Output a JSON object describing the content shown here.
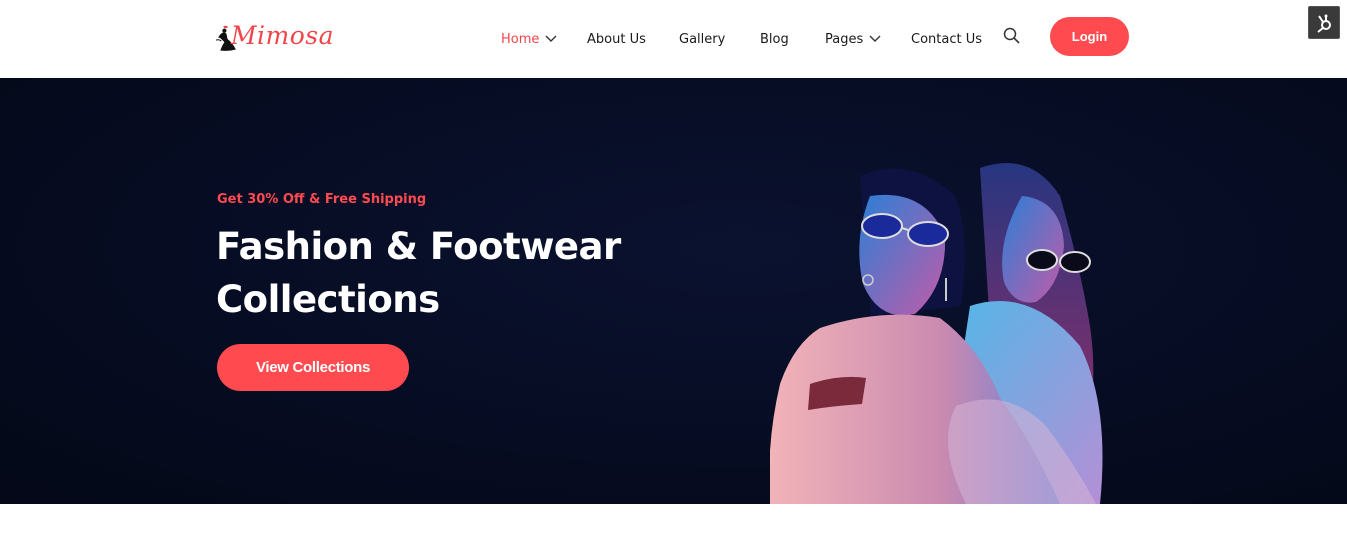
{
  "brand": {
    "name": "Mimosa"
  },
  "nav": {
    "items": [
      {
        "label": "Home",
        "active": true,
        "has_dropdown": true
      },
      {
        "label": "About Us",
        "active": false,
        "has_dropdown": false
      },
      {
        "label": "Gallery",
        "active": false,
        "has_dropdown": false
      },
      {
        "label": "Blog",
        "active": false,
        "has_dropdown": false
      },
      {
        "label": "Pages",
        "active": false,
        "has_dropdown": true
      },
      {
        "label": "Contact Us",
        "active": false,
        "has_dropdown": false
      }
    ],
    "search_icon": "search-icon",
    "login_label": "Login"
  },
  "hero": {
    "promo": "Get 30% Off & Free Shipping",
    "headline": "Fashion & Footwear Collections",
    "cta_label": "View Collections"
  },
  "colors": {
    "accent": "#ff4a4f",
    "hero_bg": "#060c22",
    "text_dark": "#1a1a1a",
    "white": "#ffffff"
  }
}
